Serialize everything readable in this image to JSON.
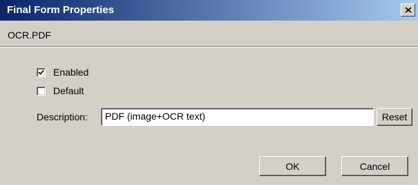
{
  "window": {
    "title": "Final Form Properties",
    "close_label": "×"
  },
  "form": {
    "file_name": "OCR.PDF",
    "enabled": {
      "label": "Enabled",
      "checked": true
    },
    "default": {
      "label": "Default",
      "checked": false
    },
    "description": {
      "label": "Description:",
      "value": "PDF (image+OCR text)"
    },
    "reset_label": "Reset"
  },
  "buttons": {
    "ok": "OK",
    "cancel": "Cancel"
  },
  "icons": {
    "close": "close-icon",
    "check": "checkmark-icon"
  },
  "colors": {
    "title_gradient_start": "#0a246a",
    "title_gradient_end": "#a6caf0",
    "face": "#d4d0c8"
  }
}
